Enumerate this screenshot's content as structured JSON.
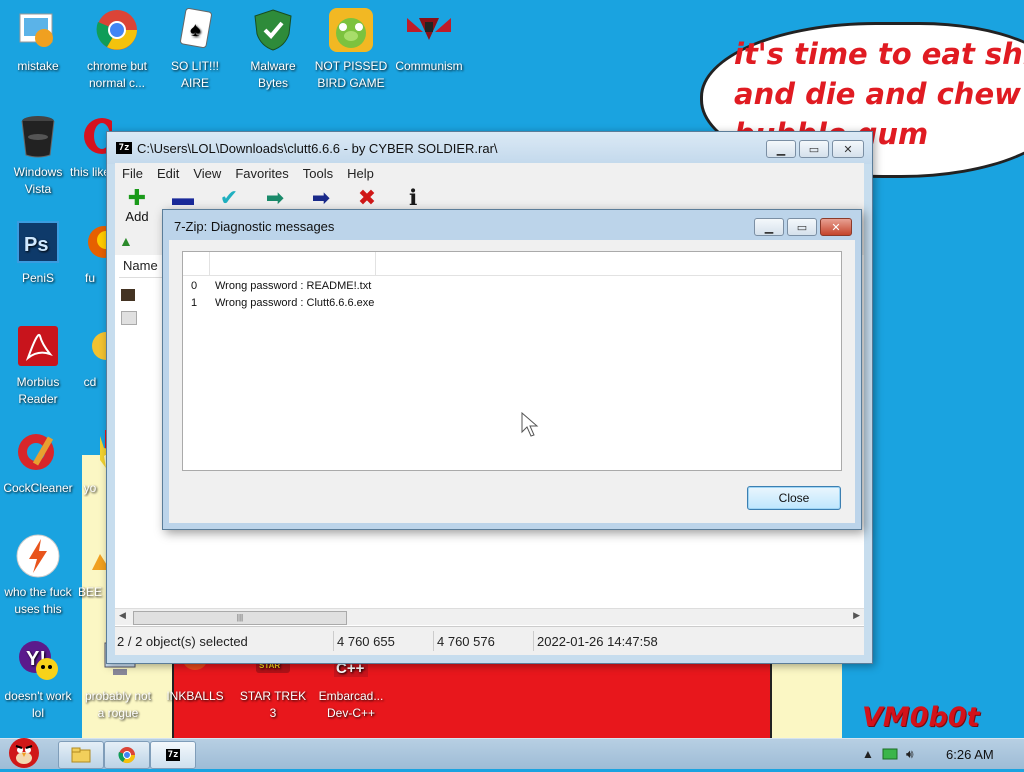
{
  "desktop": {
    "speech_lines": [
      "it's time to eat shit",
      "and die and chew",
      "bubble gum"
    ],
    "watermark": "VM0b0t",
    "icons": [
      {
        "label": "mistake",
        "icon": "picture-icon"
      },
      {
        "label": "chrome but normal c...",
        "icon": "chrome-icon"
      },
      {
        "label": "SO LIT!!! AIRE",
        "icon": "cards-icon"
      },
      {
        "label": "Malware Bytes",
        "icon": "shield-icon"
      },
      {
        "label": "NOT PISSED BIRD GAME",
        "icon": "pig-icon"
      },
      {
        "label": "Communism",
        "icon": "communism-icon"
      },
      {
        "label": "Windows Vista",
        "icon": "trash-icon"
      },
      {
        "label": "this like",
        "icon": "opera-icon"
      },
      {
        "label": "PeniS",
        "icon": "photoshop-icon"
      },
      {
        "label": "fu",
        "icon": "firefox-icon"
      },
      {
        "label": "Morbius Reader",
        "icon": "pdf-icon"
      },
      {
        "label": "cd",
        "icon": "disc-icon"
      },
      {
        "label": "CockCleaner",
        "icon": "ccleaner-icon"
      },
      {
        "label": "yo",
        "icon": "star-icon"
      },
      {
        "label": "who the fuck uses this",
        "icon": "lightning-icon"
      },
      {
        "label": "BEE",
        "icon": "bee-icon"
      },
      {
        "label": "doesn't work lol",
        "icon": "yahoo-icon"
      },
      {
        "label": "probably not a rogue",
        "icon": "computer-icon"
      },
      {
        "label": "INKBALLS",
        "icon": "inkball-icon"
      },
      {
        "label": "STAR TREK 3",
        "icon": "startrek-icon"
      },
      {
        "label": "Embarcad... Dev-C++",
        "icon": "cpp-icon"
      }
    ]
  },
  "main_window": {
    "title": "C:\\Users\\LOL\\Downloads\\clutt6.6.6 - by CYBER SOLDIER.rar\\",
    "app_badge": "7z",
    "menu": [
      "File",
      "Edit",
      "View",
      "Favorites",
      "Tools",
      "Help"
    ],
    "toolbar": {
      "add_label": "Add"
    },
    "list_header": "Name",
    "status": {
      "selection": "2 / 2 object(s) selected",
      "size": "4 760 655",
      "packed": "4 760 576",
      "modified": "2022-01-26 14:47:58"
    }
  },
  "dialog": {
    "title": "7-Zip: Diagnostic messages",
    "messages": [
      {
        "index": "0",
        "text": "Wrong password : README!.txt"
      },
      {
        "index": "1",
        "text": "Wrong password : Clutt6.6.6.exe"
      }
    ],
    "close_label": "Close"
  },
  "taskbar": {
    "clock": "6:26 AM"
  },
  "colors": {
    "desktop_blue": "#1aa3e0",
    "speech_red": "#e01b22",
    "window_frame": "#c7ddee"
  }
}
